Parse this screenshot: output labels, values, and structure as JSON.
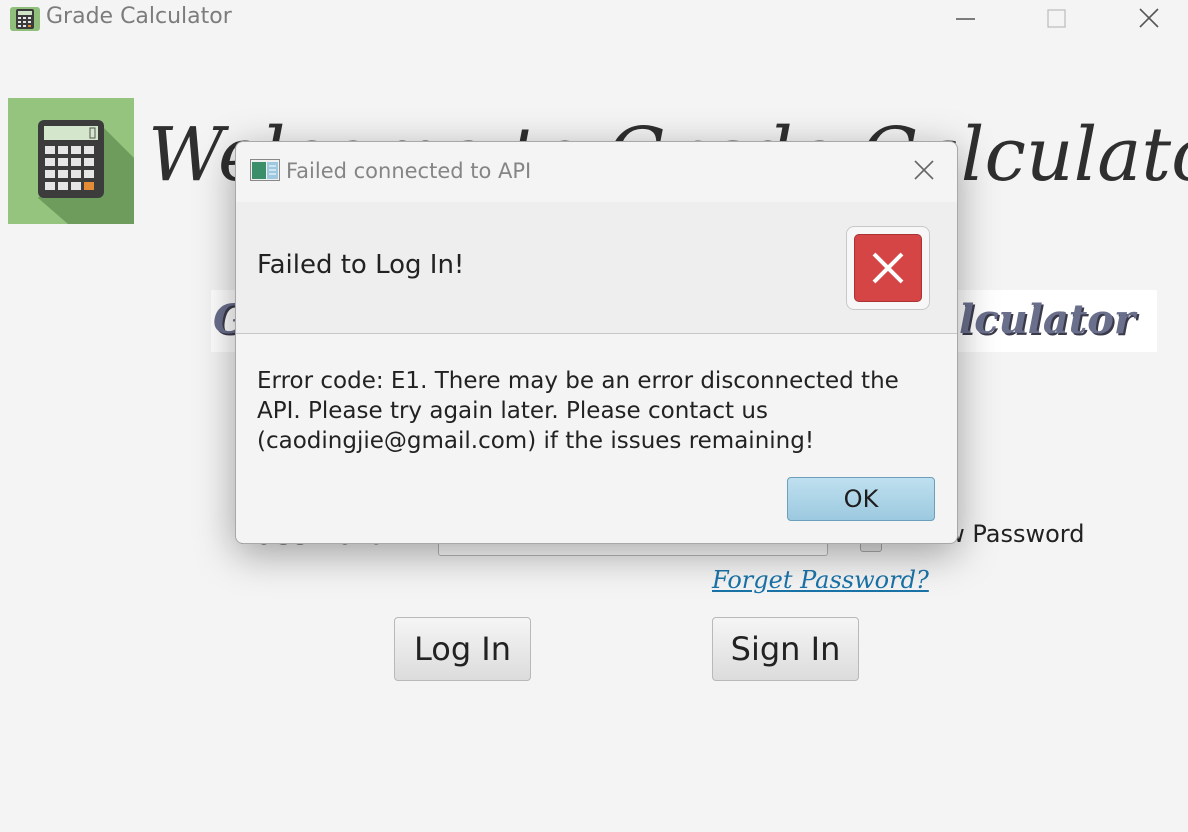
{
  "window": {
    "title": "Grade Calculator",
    "icon": "calculator-icon"
  },
  "main": {
    "welcome_text": "Welcome to Grade Calculator",
    "banner_text_left": "G",
    "banner_text_right": "lculator",
    "password_label": "Password:",
    "password_value": "••••••••",
    "show_password_label": "Show Password",
    "forget_password_link": "Forget Password?",
    "login_button": "Log In",
    "signin_button": "Sign In"
  },
  "dialog": {
    "title": "Failed connected to API",
    "header": "Failed to Log In!",
    "body": "Error code: E1. There may be an error disconnected the API. Please try again later. Please contact us (caodingjie@gmail.com) if the issues remaining!",
    "ok_button": "OK",
    "icon": "error-x-icon"
  },
  "colors": {
    "error_red": "#d64545",
    "ok_button_blue": "#9cc9df",
    "link_blue": "#1a73a8"
  }
}
